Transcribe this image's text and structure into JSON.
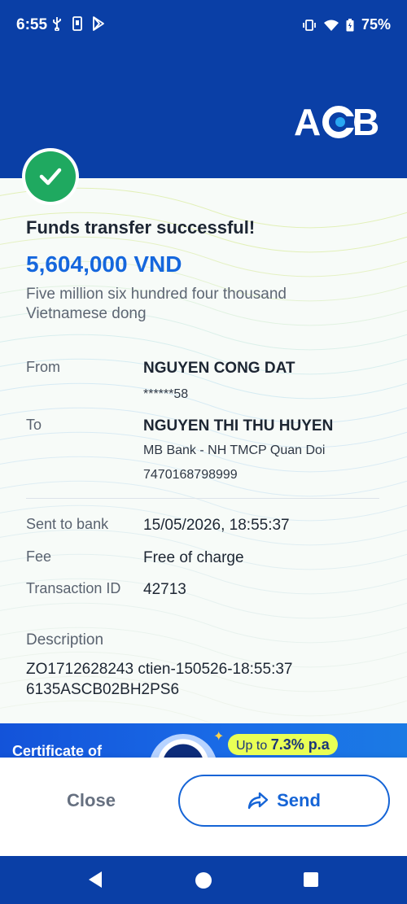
{
  "status_bar": {
    "time": "6:55",
    "battery": "75%"
  },
  "header": {
    "logo_text": "ACB"
  },
  "receipt": {
    "title": "Funds transfer successful!",
    "amount": "5,604,000 VND",
    "amount_words": "Five million six hundred four thousand Vietnamese dong",
    "from": {
      "label": "From",
      "name": "NGUYEN CONG DAT",
      "account": "******58"
    },
    "to": {
      "label": "To",
      "name": "NGUYEN THI THU HUYEN",
      "bank": "MB Bank - NH TMCP Quan Doi",
      "account": "7470168798999"
    },
    "sent_to_bank": {
      "label": "Sent to bank",
      "value": "15/05/2026, 18:55:37"
    },
    "fee": {
      "label": "Fee",
      "value": "Free of charge"
    },
    "transaction_id": {
      "label": "Transaction ID",
      "value": "42713"
    },
    "description": {
      "label": "Description",
      "value": "ZO1712628243 ctien-150526-18:55:37 6135ASCB02BH2PS6"
    }
  },
  "banner": {
    "text": "Certificate of",
    "rate_prefix": "Up to ",
    "rate": "7.3% p.a"
  },
  "actions": {
    "close_label": "Close",
    "send_label": "Send"
  },
  "colors": {
    "brand_blue": "#0a3fa6",
    "accent_blue": "#1567dd",
    "success_green": "#1fa960"
  },
  "icons": {
    "check": "check-icon",
    "send": "share-arrow-icon"
  }
}
